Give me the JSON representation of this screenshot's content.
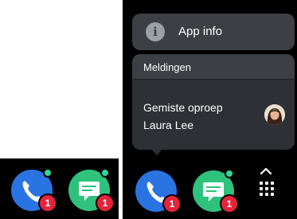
{
  "shortcut_menu": {
    "app_info_label": "App info",
    "notifications": {
      "header": "Meldingen",
      "title": "Gemiste oproep",
      "name": "Laura Lee"
    }
  },
  "dock_left": {
    "phone_badge": "1",
    "messages_badge": "1"
  },
  "dock_right": {
    "phone_badge": "1",
    "messages_badge": "1"
  },
  "icons": {
    "app_info": "info-icon",
    "phone": "phone-icon",
    "messages": "message-icon",
    "expand": "chevron-up-icon",
    "drawer": "app-drawer-icon"
  },
  "colors": {
    "phone_app": "#2a73e3",
    "messages_app": "#2fc27d",
    "badge": "#e3243b",
    "notification_dot": "#2fd3a0",
    "menu_surface": "#3c3f44"
  }
}
